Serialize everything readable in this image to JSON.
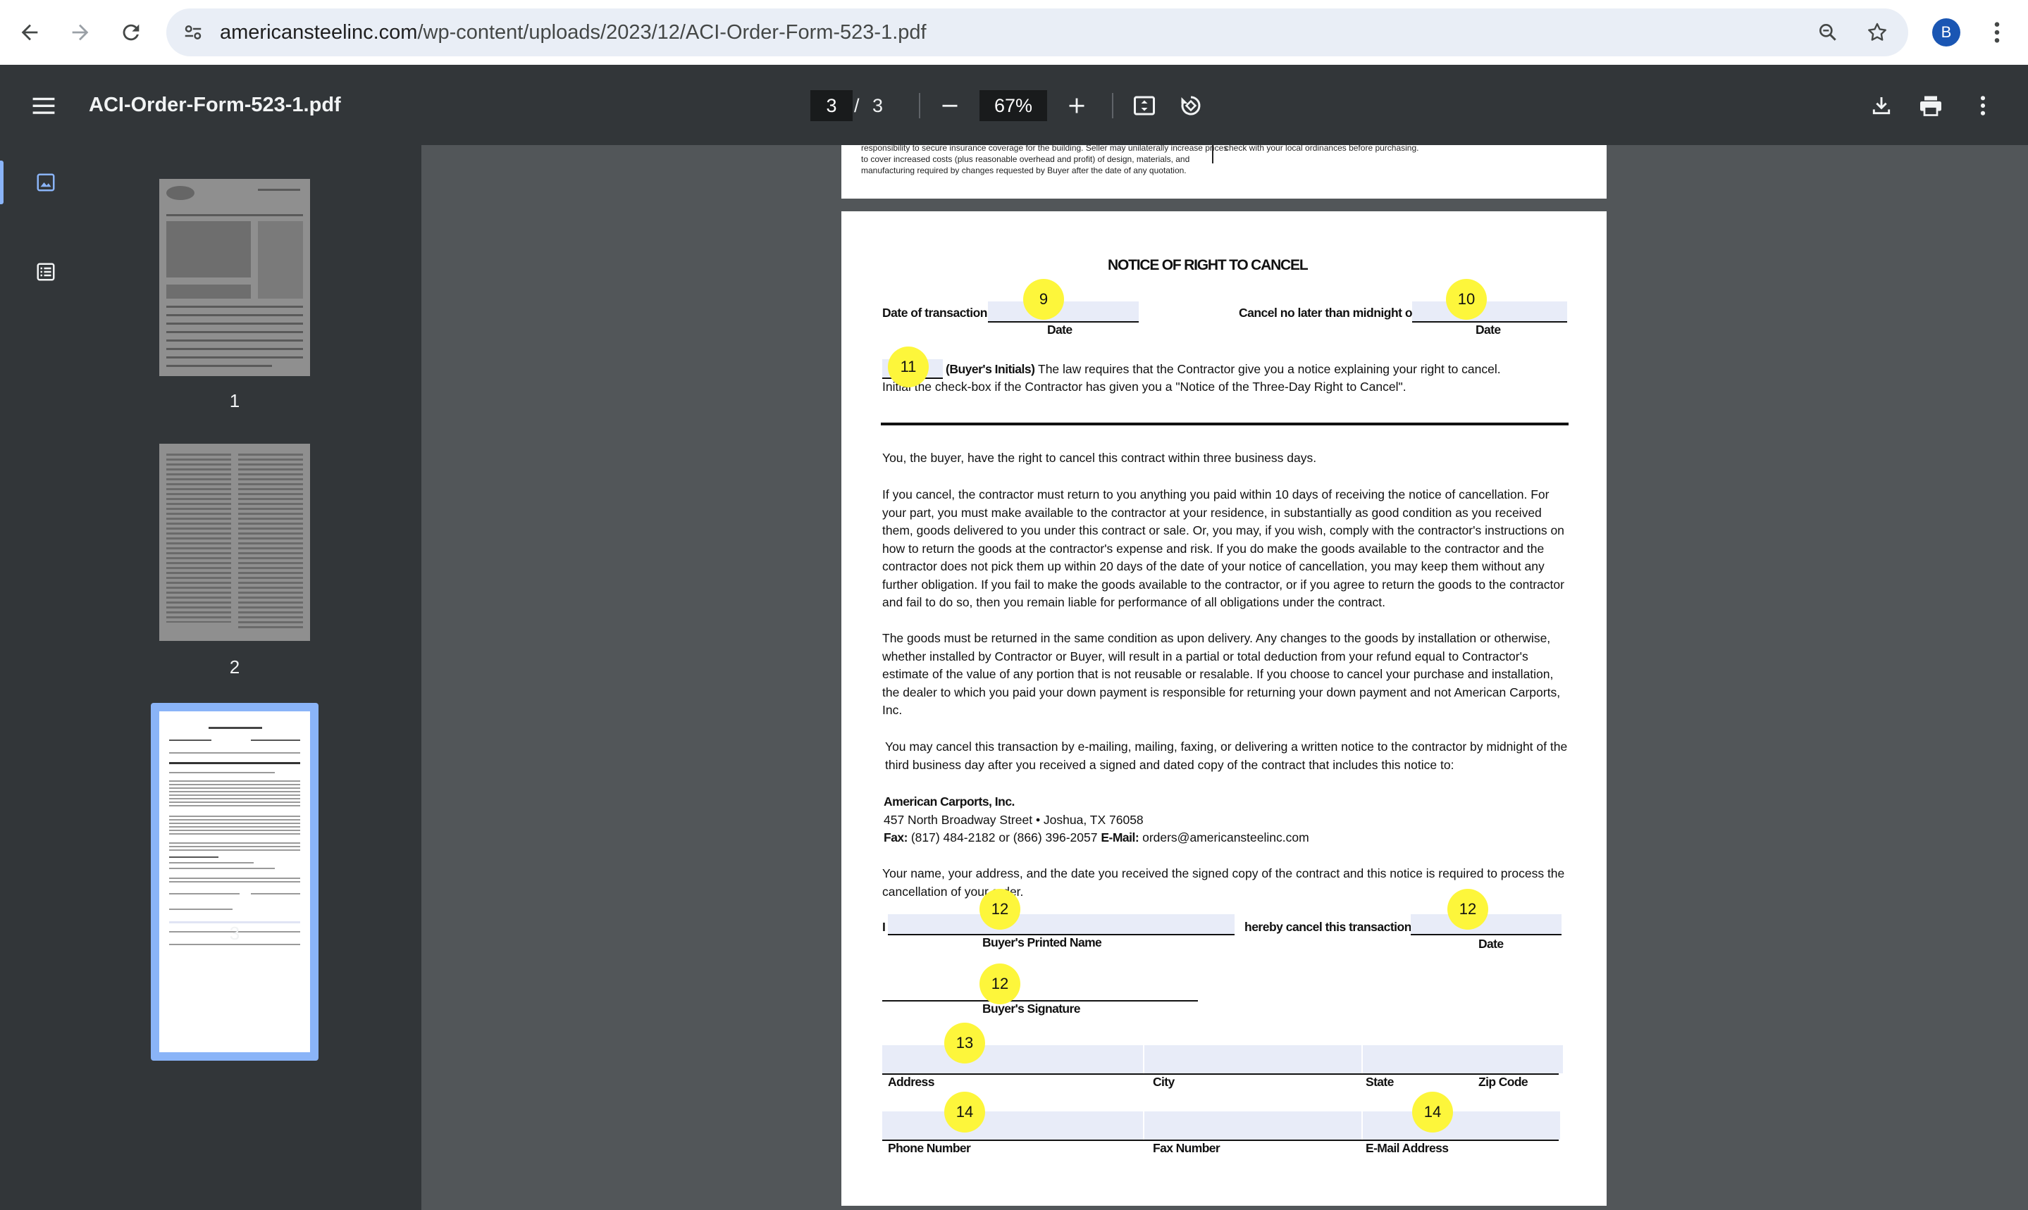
{
  "browser": {
    "url_host": "americansteelinc.com",
    "url_path": "/wp-content/uploads/2023/12/ACI-Order-Form-523-1.pdf",
    "avatar_letter": "B",
    "icons": [
      "back-icon",
      "forward-icon",
      "reload-icon",
      "site-info-icon",
      "zoom-icon",
      "star-icon",
      "kebab-menu-icon"
    ]
  },
  "toolbar": {
    "title": "ACI-Order-Form-523-1.pdf",
    "page_current": "3",
    "page_separator": "/",
    "page_total": "3",
    "zoom": "67%"
  },
  "sidebar": {
    "thumbnails": [
      {
        "label": "1"
      },
      {
        "label": "2"
      },
      {
        "label": "3",
        "selected": true
      }
    ]
  },
  "prev_page": {
    "line1": "responsibility to secure insurance coverage for the building. Seller may unilaterally increase prices",
    "line2": "to cover increased costs (plus reasonable overhead and profit) of design, materials, and",
    "line3": "manufacturing required by changes requested by Buyer after the date of any quotation.",
    "right_line": "check with your local ordinances before purchasing."
  },
  "page": {
    "title": "NOTICE OF RIGHT TO CANCEL",
    "date_of_transaction": "Date of transaction",
    "date_label_1": "Date",
    "cancel_no_later": "Cancel no later than midnight of",
    "date_label_2": "Date",
    "buyers_initials": "(Buyer's Initials)",
    "initials_text": " The law requires that the Contractor give you a notice explaining your right to cancel.",
    "initials_text2": "Initial the check-box if the Contractor has given you a \"Notice of the Three-Day Right to Cancel\".",
    "para1": "You, the buyer, have the right to cancel this contract within three business days.",
    "para2": [
      "If you cancel, the contractor must return to you anything you paid within 10 days of receiving the notice of cancellation. For",
      "your part, you must make available to the contractor at your residence, in substantially as good condition as you received",
      "them, goods delivered to you under this contract or sale. Or, you may, if you wish, comply with the contractor's instructions on",
      "how to return the goods at the contractor's expense and risk. If you do make the goods available to the contractor and the",
      "contractor does not pick them up within 20 days of the date of your notice of cancellation, you may keep them without any",
      "further obligation. If you fail to make the goods available to the contractor, or if you agree to return the goods to the contractor",
      "and fail to do so, then you remain liable for performance of all obligations under the contract."
    ],
    "para3": [
      "The goods must be returned in the same condition as upon delivery. Any changes to the goods by installation or otherwise,",
      "whether installed by Contractor or Buyer, will result in a partial or total deduction from your refund equal to Contractor's",
      "estimate of the value of any portion that is not reusable or resalable. If you choose to cancel your purchase and installation,",
      "the dealer to which you paid your down payment is responsible for returning your down payment and not American Carports,",
      "Inc."
    ],
    "para4": [
      "You may cancel this transaction by e-mailing, mailing, faxing, or delivering a written notice to the contractor by midnight of the",
      "third business day after you received a signed and dated copy of the contract that includes this notice to:"
    ],
    "company": "American Carports, Inc.",
    "address": "457 North Broadway Street • Joshua, TX 76058",
    "fax_label": "Fax:",
    "fax_value": " (817) 484-2182 or (866) 396-2057 ",
    "email_label": "E-Mail:",
    "email_value": " orders@americansteelinc.com",
    "para5_1": "Your name, your address, and the date you received the signed copy of the contract and this notice is required to process the",
    "para5_2": "cancellation of your order.",
    "i_label": "I",
    "printed_name": "Buyer's Printed  Name",
    "hereby_cancel": "hereby cancel this transaction",
    "date_label_3": "Date",
    "signature": "Buyer's Signature",
    "address_label": "Address",
    "city_label": "City",
    "state_label": "State",
    "zip_label": "Zip Code",
    "phone_label": "Phone Number",
    "fax_number_label": "Fax Number",
    "email_address_label": "E-Mail Address"
  },
  "markers": {
    "m9": "9",
    "m10": "10",
    "m11": "11",
    "m12a": "12",
    "m12b": "12",
    "m12c": "12",
    "m13": "13",
    "m14a": "14",
    "m14b": "14"
  }
}
